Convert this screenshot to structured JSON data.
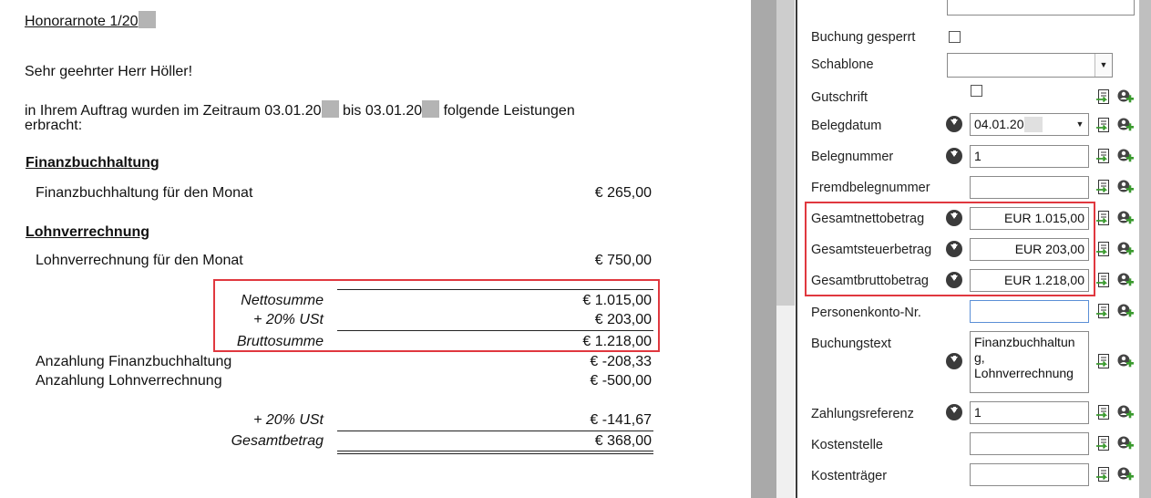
{
  "document": {
    "title": "Honorarnote 1/20",
    "salutation": "Sehr geehrter Herr Höller!",
    "intro_part1": "in Ihrem Auftrag wurden im Zeitraum 03.01.20",
    "intro_part2": "bis 03.01.20",
    "intro_part3": "folgende Leistungen",
    "intro_line2": "erbracht:",
    "sections": [
      {
        "heading": "Finanzbuchhaltung",
        "item": "Finanzbuchhaltung für den Monat",
        "amount": "€ 265,00"
      },
      {
        "heading": "Lohnverrechnung",
        "item": "Lohnverrechnung für den Monat",
        "amount": "€ 750,00"
      }
    ],
    "totals": [
      {
        "label": "Nettosumme",
        "amount": "€ 1.015,00"
      },
      {
        "label": "+ 20% USt",
        "amount": "€ 203,00"
      },
      {
        "label": "Bruttosumme",
        "amount": "€ 1.218,00"
      }
    ],
    "deductions": [
      {
        "label": "Anzahlung Finanzbuchhaltung",
        "amount": "€ -208,33"
      },
      {
        "label": "Anzahlung Lohnverrechnung",
        "amount": "€ -500,00"
      }
    ],
    "final": [
      {
        "label": "+ 20% USt",
        "amount": "€ -141,67"
      },
      {
        "label": "Gesamtbetrag",
        "amount": "€ 368,00"
      }
    ]
  },
  "form": {
    "buchung_gesperrt": {
      "label": "Buchung gesperrt",
      "checked": false
    },
    "schablone": {
      "label": "Schablone",
      "value": ""
    },
    "gutschrift": {
      "label": "Gutschrift",
      "checked": false
    },
    "belegdatum": {
      "label": "Belegdatum",
      "value": "04.01.20"
    },
    "belegnummer": {
      "label": "Belegnummer",
      "value": "1"
    },
    "fremdbelegnummer": {
      "label": "Fremdbelegnummer",
      "value": ""
    },
    "gesamtnettobetrag": {
      "label": "Gesamtnettobetrag",
      "value": "EUR 1.015,00"
    },
    "gesamtsteuerbetrag": {
      "label": "Gesamtsteuerbetrag",
      "value": "EUR 203,00"
    },
    "gesamtbruttobetrag": {
      "label": "Gesamtbruttobetrag",
      "value": "EUR 1.218,00"
    },
    "personenkonto": {
      "label": "Personenkonto-Nr.",
      "value": ""
    },
    "buchungstext": {
      "label": "Buchungstext",
      "lines": [
        "Finanzbuchhaltun",
        "g,",
        "Lohnverrechnung"
      ]
    },
    "zahlungsreferenz": {
      "label": "Zahlungsreferenz",
      "value": "1"
    },
    "kostenstelle": {
      "label": "Kostenstelle",
      "value": ""
    },
    "kostentraeger": {
      "label": "Kostenträger",
      "value": ""
    }
  },
  "colors": {
    "highlight": "#e0383f",
    "icon_green": "#3a9a2e",
    "field_focus": "#5b8fd6"
  },
  "icons": {
    "download": "circle-down-arrow-icon",
    "assign": "document-arrow-icon",
    "add": "person-plus-icon"
  }
}
